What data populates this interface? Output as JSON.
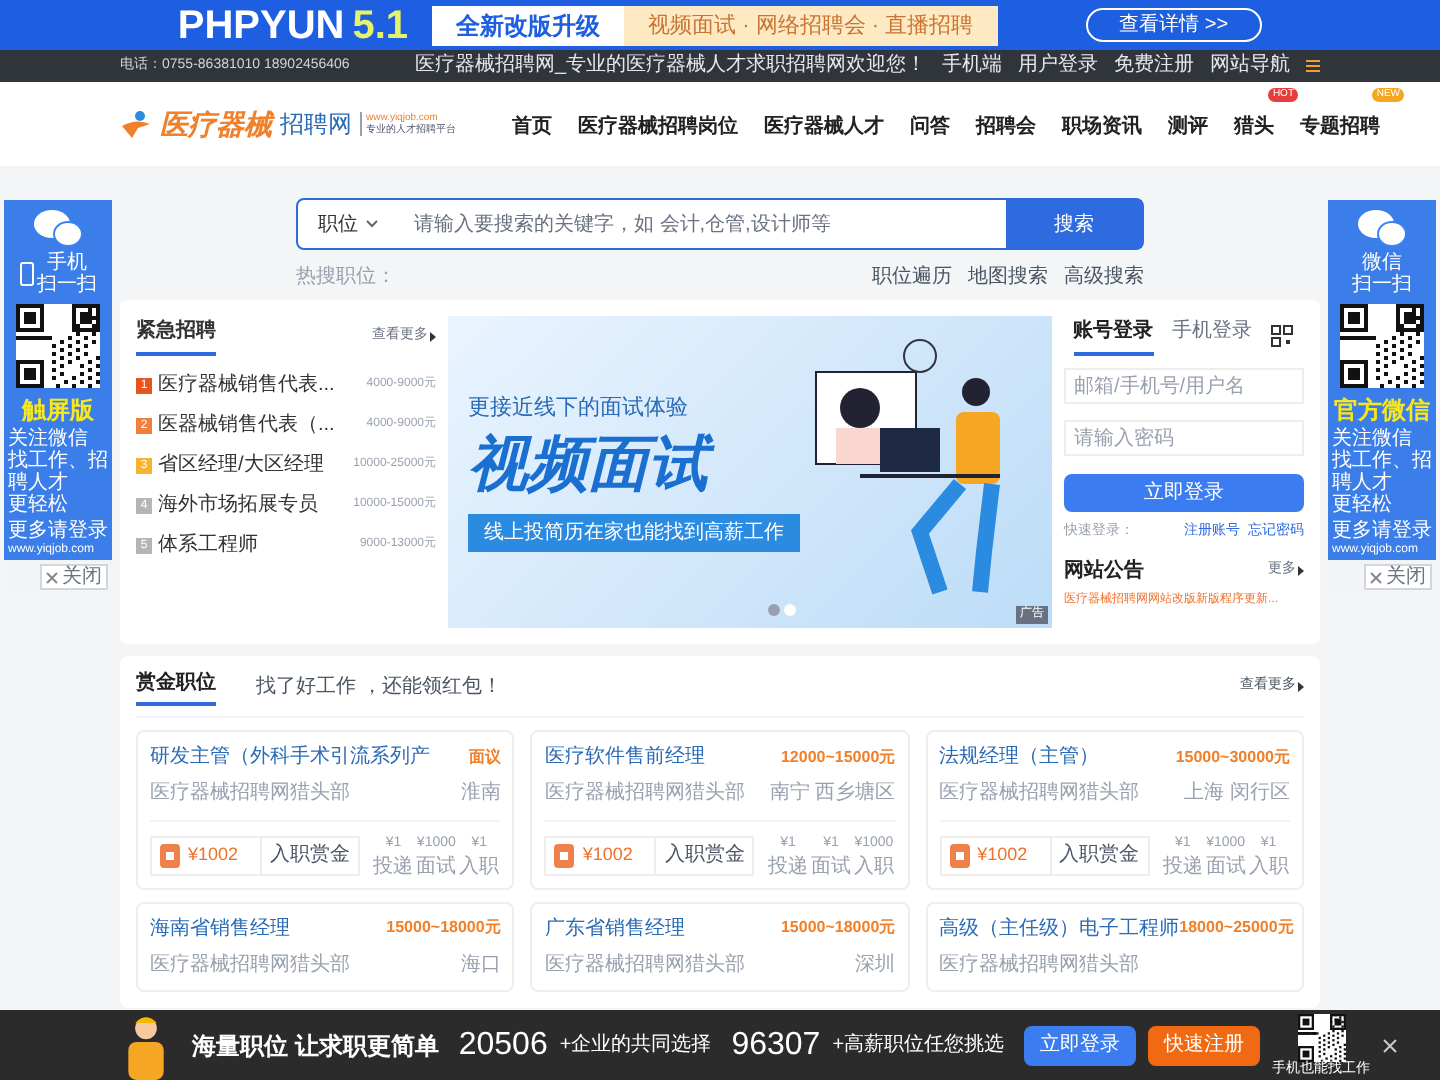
{
  "top_banner": {
    "brand": "PHPYUN",
    "version": "5.1",
    "headline": "全新改版升级",
    "tagline": "视频面试 · 网络招聘会 · 直播招聘",
    "button": "查看详情 >>"
  },
  "top_bar": {
    "phone": "电话：0755-86381010 18902456406",
    "welcome": "医疗器械招聘网_专业的医疗器械人才求职招聘网欢迎您！",
    "links": [
      "手机端",
      "用户登录",
      "免费注册",
      "网站导航"
    ]
  },
  "header": {
    "logo": {
      "name": "医疗器械",
      "suffix": "招聘网",
      "url": "www.yiqjob.com",
      "slogan": "专业的人才招聘平台"
    },
    "nav": [
      {
        "label": "首页"
      },
      {
        "label": "医疗器械招聘岗位"
      },
      {
        "label": "医疗器械人才"
      },
      {
        "label": "问答"
      },
      {
        "label": "招聘会"
      },
      {
        "label": "职场资讯"
      },
      {
        "label": "测评"
      },
      {
        "label": "猎头",
        "badge": "HOT",
        "kind": "hot"
      },
      {
        "label": "专题招聘",
        "badge": "NEW",
        "kind": "new"
      }
    ]
  },
  "search": {
    "category": "职位",
    "placeholder": "请输入要搜索的关键字，如 会计,仓管,设计师等",
    "button": "搜索",
    "hot_label": "热搜职位：",
    "links": [
      "职位遍历",
      "地图搜索",
      "高级搜索"
    ]
  },
  "side_ads": [
    {
      "scan": [
        "手机",
        "扫一扫"
      ],
      "title": "触屏版",
      "lines": [
        "关注微信",
        "找工作、招聘人才",
        "更轻松"
      ],
      "more": "更多请登录",
      "url": "www.yiqjob.com",
      "close": "关闭"
    },
    {
      "scan": [
        "微信",
        "扫一扫"
      ],
      "title": "官方微信",
      "lines": [
        "关注微信",
        "找工作、招聘人才",
        "更轻松"
      ],
      "more": "更多请登录",
      "url": "www.yiqjob.com",
      "close": "关闭"
    }
  ],
  "urgent": {
    "title": "紧急招聘",
    "more": "查看更多",
    "items": [
      {
        "rank": "1",
        "color": "#e8541e",
        "title": "医疗器械销售代表...",
        "salary": "4000-9000元"
      },
      {
        "rank": "2",
        "color": "#f0803c",
        "title": "医器械销售代表（...",
        "salary": "4000-9000元"
      },
      {
        "rank": "3",
        "color": "#f5b330",
        "title": "省区经理/大区经理",
        "salary": "10000-25000元"
      },
      {
        "rank": "4",
        "color": "#b5b5b5",
        "title": "海外市场拓展专员",
        "salary": "10000-15000元"
      },
      {
        "rank": "5",
        "color": "#b5b5b5",
        "title": "体系工程师",
        "salary": "9000-13000元"
      }
    ]
  },
  "promo": {
    "subtitle": "更接近线下的面试体验",
    "title": "视频面试",
    "caption": "线上投简历在家也能找到高薪工作",
    "ad": "广告",
    "slides": [
      {
        "selected": false
      },
      {
        "selected": true
      }
    ]
  },
  "login": {
    "tabs": [
      {
        "label": "账号登录",
        "selected": true
      },
      {
        "label": "手机登录",
        "selected": false
      }
    ],
    "user_placeholder": "邮箱/手机号/用户名",
    "password_placeholder": "请输入密码",
    "button": "立即登录",
    "quick": "快速登录：",
    "register": "注册账号",
    "forgot": "忘记密码",
    "notice_title": "网站公告",
    "notice_more": "更多",
    "notice": "医疗器械招聘网网站改版新版程序更新..."
  },
  "reward": {
    "title": "赏金职位",
    "subtitle": "找了好工作 ，还能领红包！",
    "more": "查看更多",
    "jobs": [
      {
        "title": "研发主管（外科手术引流系列产",
        "salary": "面议",
        "company": "医疗器械招聘网猎头部",
        "location": "淮南",
        "reward": "¥1002",
        "reward_label": "入职赏金",
        "steps": [
          {
            "amount": "¥1",
            "label": "投递"
          },
          {
            "amount": "¥1000",
            "label": "面试"
          },
          {
            "amount": "¥1",
            "label": "入职"
          }
        ]
      },
      {
        "title": "医疗软件售前经理",
        "salary": "12000~15000元",
        "company": "医疗器械招聘网猎头部",
        "location": "南宁 西乡塘区",
        "reward": "¥1002",
        "reward_label": "入职赏金",
        "steps": [
          {
            "amount": "¥1",
            "label": "投递"
          },
          {
            "amount": "¥1",
            "label": "面试"
          },
          {
            "amount": "¥1000",
            "label": "入职"
          }
        ]
      },
      {
        "title": "法规经理（主管）",
        "salary": "15000~30000元",
        "company": "医疗器械招聘网猎头部",
        "location": "上海 闵行区",
        "reward": "¥1002",
        "reward_label": "入职赏金",
        "steps": [
          {
            "amount": "¥1",
            "label": "投递"
          },
          {
            "amount": "¥1000",
            "label": "面试"
          },
          {
            "amount": "¥1",
            "label": "入职"
          }
        ]
      },
      {
        "title": "海南省销售经理",
        "salary": "15000~18000元",
        "company": "医疗器械招聘网猎头部",
        "location": "海口"
      },
      {
        "title": "广东省销售经理",
        "salary": "15000~18000元",
        "company": "医疗器械招聘网猎头部",
        "location": "深圳"
      },
      {
        "title": "高级（主任级）电子工程师",
        "salary": "18000~25000元",
        "company": "医疗器械招聘网猎头部"
      }
    ]
  },
  "bottom_bar": {
    "slogan": "海量职位 让求职更简单",
    "companies": "20506",
    "companies_label": "+企业的共同选择",
    "jobs": "96307",
    "jobs_label": "+高薪职位任您挑选",
    "login": "立即登录",
    "register": "快速注册",
    "qr_caption": "手机也能找工作"
  }
}
